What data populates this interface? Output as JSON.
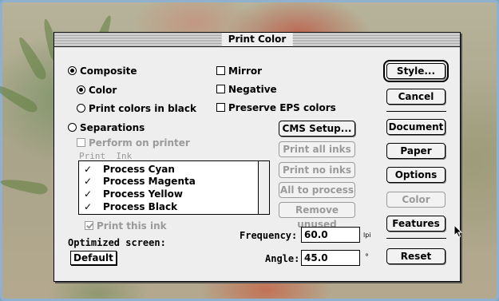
{
  "dialog": {
    "title": "Print Color"
  },
  "options": {
    "composite_label": "Composite",
    "composite_selected": true,
    "color_label": "Color",
    "color_selected": true,
    "print_black_label": "Print colors in black",
    "print_black_selected": false,
    "separations_label": "Separations",
    "separations_selected": false,
    "perform_on_printer_label": "Perform on printer",
    "mirror_label": "Mirror",
    "negative_label": "Negative",
    "preserve_eps_label": "Preserve EPS colors"
  },
  "inks": {
    "header_print": "Print",
    "header_ink": "Ink",
    "items": [
      {
        "mark": "✓",
        "name": "Process Cyan"
      },
      {
        "mark": "✓",
        "name": "Process Magenta"
      },
      {
        "mark": "✓",
        "name": "Process Yellow"
      },
      {
        "mark": "✓",
        "name": "Process Black"
      }
    ],
    "print_this_ink_label": "Print this ink"
  },
  "middle_buttons": {
    "cms_setup": "CMS Setup...",
    "print_all_inks": "Print all inks",
    "print_no_inks": "Print no inks",
    "all_to_process": "All to process",
    "remove_unused": "Remove unused"
  },
  "screen": {
    "optimized_label": "Optimized screen:",
    "optimized_value": "Default",
    "frequency_label": "Frequency:",
    "frequency_value": "60.0",
    "frequency_unit": "lpi",
    "angle_label": "Angle:",
    "angle_value": "45.0",
    "angle_unit": "°"
  },
  "right_buttons": {
    "style": "Style...",
    "cancel": "Cancel",
    "document": "Document",
    "paper": "Paper",
    "options": "Options",
    "color": "Color",
    "features": "Features",
    "reset": "Reset"
  }
}
